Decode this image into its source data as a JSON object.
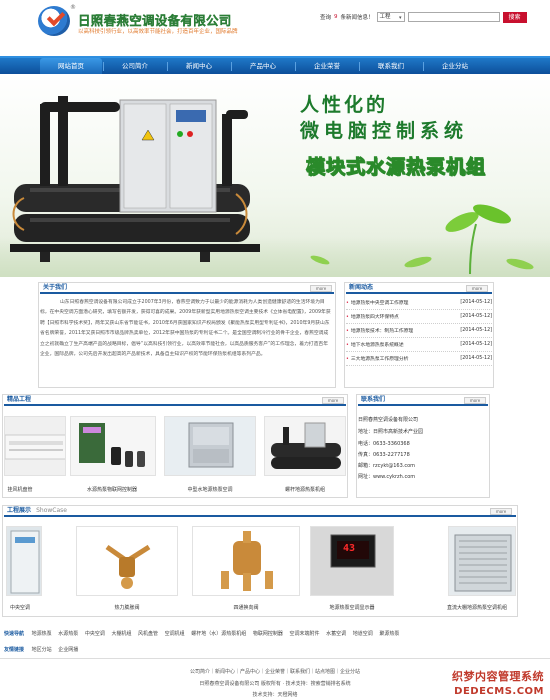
{
  "header": {
    "company_name": "日照春燕空调设备有限公司",
    "registered_mark": "®",
    "slogan": "以高科技引领行业，以高效率节能社会，打造百年企业，国际品牌",
    "search_label": "查询",
    "search_hint": "条新闻信息！",
    "search_count": "9",
    "search_select": "工程",
    "search_button": "搜索"
  },
  "nav": {
    "items": [
      "网站首页",
      "公司简介",
      "新闻中心",
      "产品中心",
      "企业荣誉",
      "联系我们",
      "企业分站"
    ]
  },
  "banner": {
    "line1": "人性化的",
    "line2": "微电脑控制系统",
    "product": "模块式水源热泵机组"
  },
  "about": {
    "title": "关于我们",
    "more": "more",
    "text": "山东日照春燕空调设备有限公司成立于2007年3月份，春燕空调致力于以最少的能源消耗为人类创造健康舒适的生活环境为目标，在中央空调方面潜心研究，填写名额开发，获得可喜的成果。2009年获新型实用地源热泵空调主要技术《立体省电配置》，2009年获聘【日照市科学技术奖】，两年又获山东省节能证书，2010年6月获国家知识产权局颁发《聚能热泵实用型专利证书》，2010年9月获山东省名牌荣誉，2011年又获日照市市级品牌热卖单位，2012年获中国热泵的专利证书二个。是全国空调制冷行业的骨干企业，春燕空调成立之初就确立了生产高端产品的战略目标，倡导“以高科技引领行业，以高效率节能社会，以高品质服务客户”的工作理念，着力打造百年企业，国际品牌，公司先后开发出超高的产品新技术，具备自主知识产权的节能环保热泵机组等系列产品。"
  },
  "news": {
    "title": "新闻动态",
    "more": "more",
    "items": [
      {
        "title": "地源热泵中央空调工作原理",
        "date": "[2014-05-12]"
      },
      {
        "title": "地源热泵四大环保特点",
        "date": "[2014-05-12]"
      },
      {
        "title": "地源热泵技术：制热工作原理",
        "date": "[2014-05-12]"
      },
      {
        "title": "地下水地源热泵系统概述",
        "date": "[2014-05-12]"
      },
      {
        "title": "三大地源热泵工作原理分析",
        "date": "[2014-05-12]"
      }
    ]
  },
  "products": {
    "title": "精品工程",
    "more": "more",
    "items": [
      {
        "caption": "挂风机盘管"
      },
      {
        "caption": "水源热泵物联网控制器"
      },
      {
        "caption": "中型水地源热泵空调"
      },
      {
        "caption": "螺杆地源热泵机组"
      }
    ]
  },
  "contact": {
    "title": "联系我们",
    "more": "more",
    "company": "日照春燕空调设备有限公司",
    "address": "地址：日照市高新技术产业园",
    "phone": "电话：0633-3360368",
    "fax": "传真：0633-2277178",
    "email": "邮箱：rzcykt@163.com",
    "web": "网址：www.cykrzh.com"
  },
  "showcase": {
    "title": "工程展示",
    "subtitle": "ShowCase",
    "more": "more",
    "items": [
      {
        "caption": "中央空调"
      },
      {
        "caption": "热力膨胀阀"
      },
      {
        "caption": "四通换向阀"
      },
      {
        "caption": "地源热泵空调显示器"
      },
      {
        "caption": "直流大棚地源热泵空调机组"
      }
    ],
    "display_value": "43"
  },
  "quick_nav": {
    "label": "快速导航",
    "links": [
      "地源热泵",
      "水源热泵",
      "中央空调",
      "大棚机组",
      "风机盘管",
      "空调机组",
      "螺杆地（水）源热泵机组",
      "物联网控制器",
      "空调末端附件",
      "水蓄空调",
      "地道空调",
      "聚源热泵"
    ]
  },
  "friend_links": {
    "label": "友情链接",
    "links": [
      "地区分站",
      "企业网播"
    ]
  },
  "footer": {
    "links_line": "公司简介｜新闻中心｜产品中心｜企业荣誉｜联系我们｜站点地图｜企业分站",
    "copyright": "日照春燕空调设备有限公司 版权所有 · 技术支持：搜索营销排名系统",
    "support": "技术支持：天橙网络"
  },
  "watermark": {
    "line1": "织梦内容管理系统",
    "line2": "DEDECMS.COM"
  },
  "colors": {
    "nav_blue": "#1659a8",
    "title_green": "#1d7a2c",
    "logo_green": "#3aa34a",
    "search_red": "#c8102e",
    "section_blue": "#1a5aa0"
  }
}
